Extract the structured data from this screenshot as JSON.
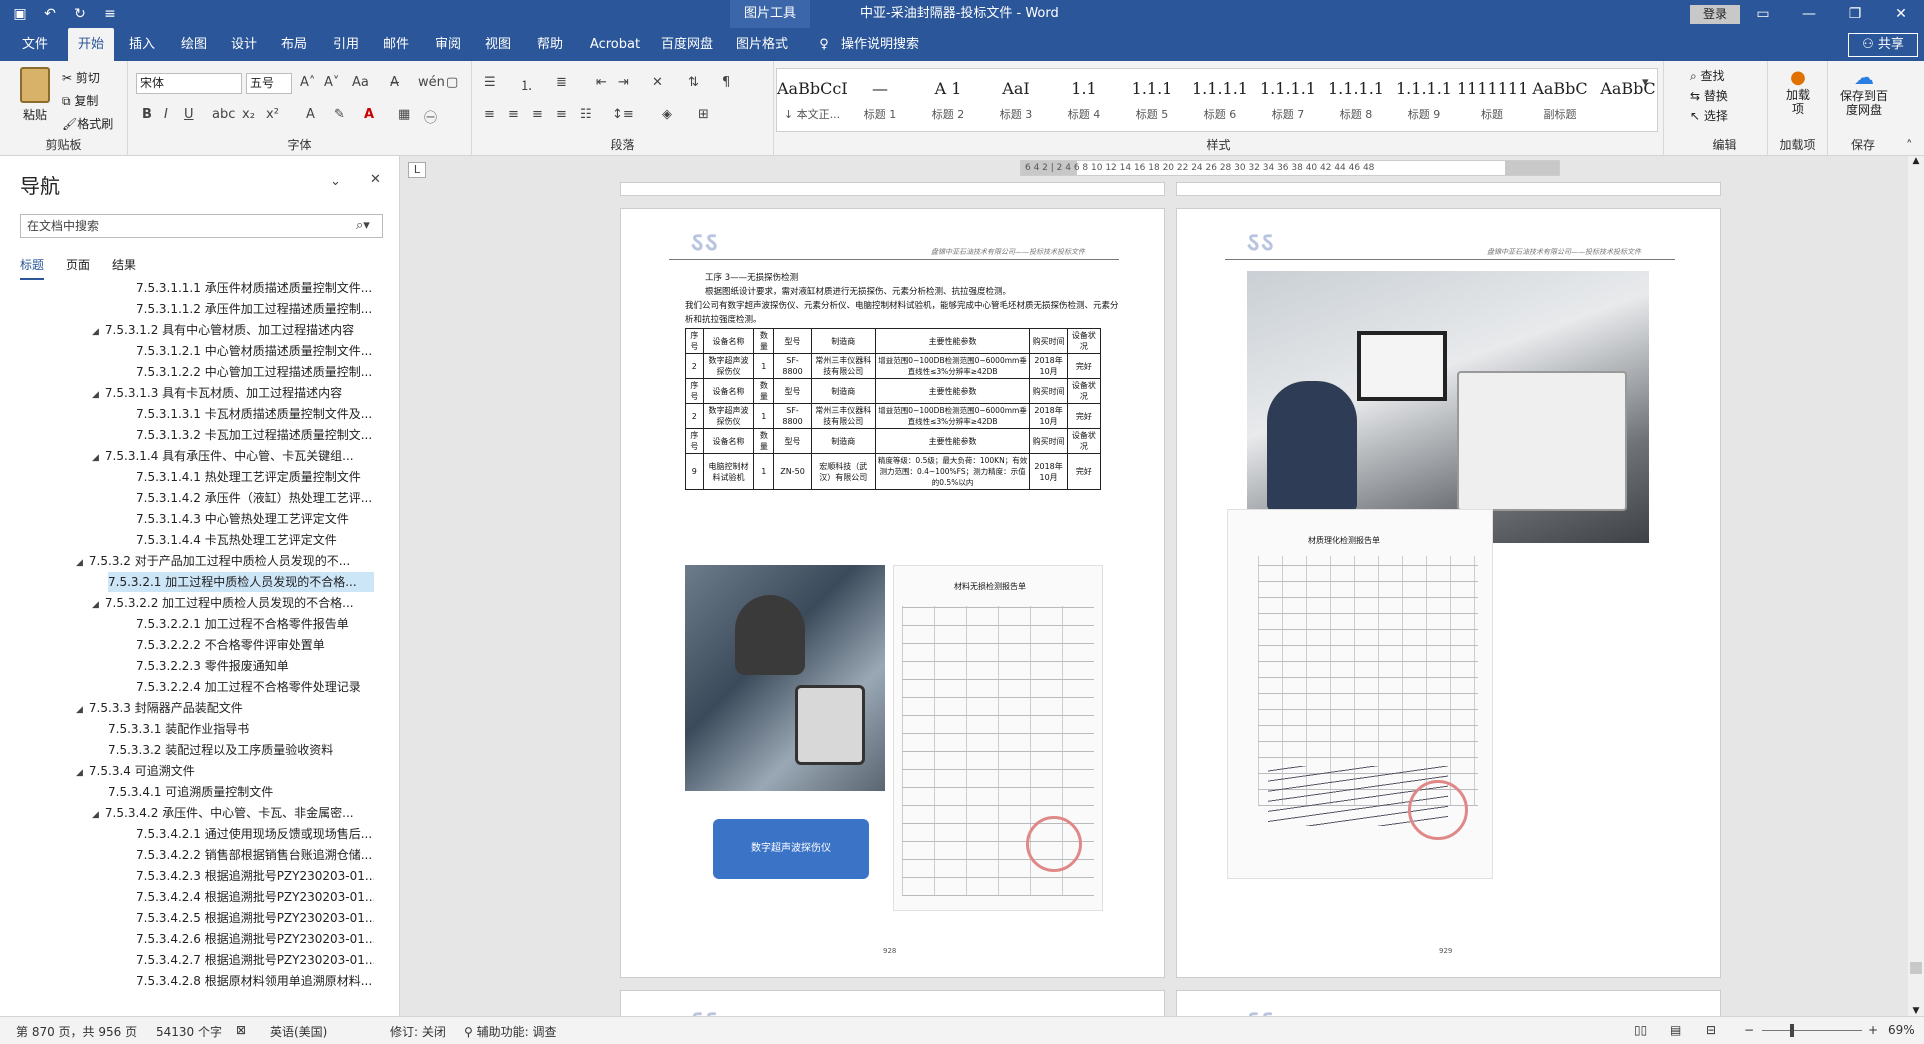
{
  "window": {
    "context_tab": "图片工具",
    "title": "中亚-采油封隔器-投标文件  -  Word",
    "login": "登录"
  },
  "tabs": [
    "文件",
    "开始",
    "插入",
    "绘图",
    "设计",
    "布局",
    "引用",
    "邮件",
    "审阅",
    "视图",
    "帮助",
    "Acrobat",
    "百度网盘",
    "图片格式"
  ],
  "active_tab": "开始",
  "tell_me": "操作说明搜索",
  "share": "共享",
  "ribbon": {
    "clipboard": {
      "paste": "粘贴",
      "cut": "剪切",
      "copy": "复制",
      "format_painter": "格式刷",
      "label": "剪贴板"
    },
    "font": {
      "name": "宋体",
      "size": "五号",
      "label": "字体"
    },
    "paragraph": {
      "label": "段落"
    },
    "styles": {
      "label": "样式",
      "items": [
        {
          "preview": "AaBbCcDdI",
          "name": "↓ 本文正..."
        },
        {
          "preview": "—",
          "name": "标题 1"
        },
        {
          "preview": "A 1",
          "name": "标题 2"
        },
        {
          "preview": "AaI",
          "name": "标题 3"
        },
        {
          "preview": "1.1",
          "name": "标题 4"
        },
        {
          "preview": "1.1.1",
          "name": "标题 5"
        },
        {
          "preview": "1.1.1.1",
          "name": "标题 6"
        },
        {
          "preview": "1.1.1.1",
          "name": "标题 7"
        },
        {
          "preview": "1.1.1.1",
          "name": "标题 8"
        },
        {
          "preview": "1.1.1.1",
          "name": "标题 9"
        },
        {
          "preview": "1111111",
          "name": "标题"
        },
        {
          "preview": "AaBbC",
          "name": "副标题"
        },
        {
          "preview": "AaBbC",
          "name": ""
        }
      ]
    },
    "editing": {
      "find": "查找",
      "replace": "替换",
      "select": "选择",
      "label": "编辑"
    },
    "addins": {
      "btn": "加载项",
      "label": "加载项"
    },
    "save": {
      "btn": "保存到百度网盘",
      "label": "保存"
    }
  },
  "nav": {
    "title": "导航",
    "search_placeholder": "在文档中搜索",
    "tabs": [
      "标题",
      "页面",
      "结果"
    ],
    "items": [
      {
        "text": "7.5.3.1.1.1 承压件材质描述质量控制文件...",
        "level": 3,
        "tri": false
      },
      {
        "text": "7.5.3.1.1.2 承压件加工过程描述质量控制...",
        "level": 3,
        "tri": false
      },
      {
        "text": "7.5.3.1.2 具有中心管材质、加工过程描述内容",
        "level": 2,
        "tri": true
      },
      {
        "text": "7.5.3.1.2.1 中心管材质描述质量控制文件...",
        "level": 3,
        "tri": false
      },
      {
        "text": "7.5.3.1.2.2 中心管加工过程描述质量控制...",
        "level": 3,
        "tri": false
      },
      {
        "text": "7.5.3.1.3 具有卡瓦材质、加工过程描述内容",
        "level": 2,
        "tri": true
      },
      {
        "text": "7.5.3.1.3.1 卡瓦材质描述质量控制文件及...",
        "level": 3,
        "tri": false
      },
      {
        "text": "7.5.3.1.3.2 卡瓦加工过程描述质量控制文...",
        "level": 3,
        "tri": false
      },
      {
        "text": "7.5.3.1.4 具有承压件、中心管、卡瓦关键组...",
        "level": 2,
        "tri": true
      },
      {
        "text": "7.5.3.1.4.1 热处理工艺评定质量控制文件",
        "level": 3,
        "tri": false
      },
      {
        "text": "7.5.3.1.4.2 承压件（液缸）热处理工艺评...",
        "level": 3,
        "tri": false
      },
      {
        "text": "7.5.3.1.4.3 中心管热处理工艺评定文件",
        "level": 3,
        "tri": false
      },
      {
        "text": "7.5.3.1.4.4 卡瓦热处理工艺评定文件",
        "level": 3,
        "tri": false
      },
      {
        "text": "7.5.3.2 对于产品加工过程中质检人员发现的不...",
        "level": 1,
        "tri": true
      },
      {
        "text": "7.5.3.2.1 加工过程中质检人员发现的不合格...",
        "level": 2,
        "tri": false,
        "selected": true
      },
      {
        "text": "7.5.3.2.2 加工过程中质检人员发现的不合格...",
        "level": 2,
        "tri": true
      },
      {
        "text": "7.5.3.2.2.1 加工过程不合格零件报告单",
        "level": 3,
        "tri": false
      },
      {
        "text": "7.5.3.2.2.2 不合格零件评审处置单",
        "level": 3,
        "tri": false
      },
      {
        "text": "7.5.3.2.2.3 零件报废通知单",
        "level": 3,
        "tri": false
      },
      {
        "text": "7.5.3.2.2.4 加工过程不合格零件处理记录",
        "level": 3,
        "tri": false
      },
      {
        "text": "7.5.3.3 封隔器产品装配文件",
        "level": 1,
        "tri": true
      },
      {
        "text": "7.5.3.3.1 装配作业指导书",
        "level": 2,
        "tri": false
      },
      {
        "text": "7.5.3.3.2 装配过程以及工序质量验收资料",
        "level": 2,
        "tri": false
      },
      {
        "text": "7.5.3.4 可追溯文件",
        "level": 1,
        "tri": true
      },
      {
        "text": "7.5.3.4.1 可追溯质量控制文件",
        "level": 2,
        "tri": false
      },
      {
        "text": "7.5.3.4.2 承压件、中心管、卡瓦、非金属密...",
        "level": 2,
        "tri": true
      },
      {
        "text": "7.5.3.4.2.1 通过使用现场反馈或现场售后...",
        "level": 3,
        "tri": false
      },
      {
        "text": "7.5.3.4.2.2 销售部根据销售台账追溯仓储...",
        "level": 3,
        "tri": false
      },
      {
        "text": "7.5.3.4.2.3 根据追溯批号PZY230203-01...",
        "level": 3,
        "tri": false
      },
      {
        "text": "7.5.3.4.2.4 根据追溯批号PZY230203-01...",
        "level": 3,
        "tri": false
      },
      {
        "text": "7.5.3.4.2.5 根据追溯批号PZY230203-01...",
        "level": 3,
        "tri": false
      },
      {
        "text": "7.5.3.4.2.6 根据追溯批号PZY230203-01...",
        "level": 3,
        "tri": false
      },
      {
        "text": "7.5.3.4.2.7 根据追溯批号PZY230203-01...",
        "level": 3,
        "tri": false
      },
      {
        "text": "7.5.3.4.2.8 根据原材料领用单追溯原材料...",
        "level": 3,
        "tri": false
      }
    ]
  },
  "ruler": "6  4  2  |  2  4  6  8  10 12 14 16 18 20 22 24 26 28 30 32 34 36 38 40 42 44 46 48",
  "page_left": {
    "header": "盘锦中亚石油技术有限公司——投标技术投标文件",
    "lines": [
      "工序 3——无损探伤检测",
      "根据图纸设计要求，需对液缸材质进行无损探伤、元素分析检测、抗拉强度检测。",
      "我们公司有数字超声波探伤仪、元素分析仪、电脑控制材料试验机，能够完成中心管毛坯材质无损探伤检测、元素分析和抗拉强度检测。"
    ],
    "table_headers": [
      "序号",
      "设备名称",
      "数量",
      "型号",
      "制造商",
      "主要性能参数",
      "购买时间",
      "设备状况"
    ],
    "rows": [
      [
        "2",
        "数字超声波探伤仪",
        "1",
        "SF-8800",
        "常州三丰仪器科技有限公司",
        "增益范围0~100DB检测范围0~6000mm垂直线性≤3%分辨率≥42DB",
        "2018年10月",
        "完好"
      ],
      [
        "2",
        "数字超声波探伤仪",
        "1",
        "SF-8800",
        "常州三丰仪器科技有限公司",
        "增益范围0~100DB检测范围0~6000mm垂直线性≤3%分辨率≥42DB",
        "2018年10月",
        "完好"
      ],
      [
        "9",
        "电脑控制材料试验机",
        "1",
        "ZN-50",
        "宏顺科技（武汉）有限公司",
        "精度等级：0.5级；最大负荷：100KN；有效测力范围：0.4~100%FS；测力精度：示值的0.5%以内",
        "2018年10月",
        "完好"
      ]
    ],
    "callout": "数字超声波探伤仪",
    "report_title": "材料无损检测报告单",
    "page_number": "928"
  },
  "page_right": {
    "header": "盘锦中亚石油技术有限公司——投标技术投标文件",
    "report_title": "材质理化检测报告单",
    "page_number": "929"
  },
  "status": {
    "page": "第 870 页，共 956 页",
    "words": "54130 个字",
    "lang": "英语(美国)",
    "track": "修订: 关闭",
    "access": "辅助功能: 调查",
    "zoom": "69%"
  }
}
